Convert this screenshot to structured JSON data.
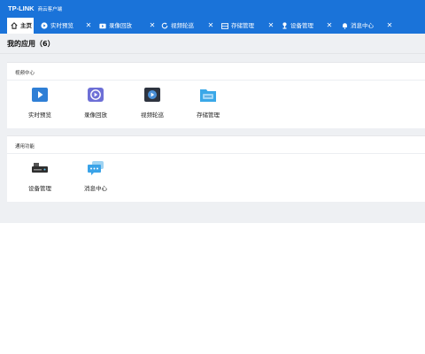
{
  "titlebar": {
    "brand": "TP-LINK",
    "subtitle": "商云客户端"
  },
  "tabs": [
    {
      "label": "主页",
      "icon": "home-icon"
    },
    {
      "label": "实时预览",
      "icon": "live-preview-icon",
      "close": "✕"
    },
    {
      "label": "录像回放",
      "icon": "playback-icon",
      "close": "✕"
    },
    {
      "label": "视频轮巡",
      "icon": "refresh-icon",
      "close": "✕"
    },
    {
      "label": "存储管理",
      "icon": "storage-icon",
      "close": "✕"
    },
    {
      "label": "设备管理",
      "icon": "device-icon",
      "close": "✕"
    },
    {
      "label": "消息中心",
      "icon": "bell-icon",
      "close": "✕"
    }
  ],
  "page": {
    "title": "我的应用（6）"
  },
  "groups": [
    {
      "header": "视频中心",
      "apps": [
        {
          "label": "实时预览",
          "icon": "live-preview-app-icon"
        },
        {
          "label": "录像回放",
          "icon": "playback-app-icon"
        },
        {
          "label": "视频轮巡",
          "icon": "video-patrol-app-icon"
        },
        {
          "label": "存储管理",
          "icon": "storage-app-icon"
        }
      ]
    },
    {
      "header": "通用功能",
      "apps": [
        {
          "label": "设备管理",
          "icon": "device-app-icon"
        },
        {
          "label": "消息中心",
          "icon": "message-app-icon"
        }
      ]
    }
  ],
  "colors": {
    "accent": "#1a73d9",
    "background": "#eef0f3",
    "panel": "#ffffff"
  }
}
